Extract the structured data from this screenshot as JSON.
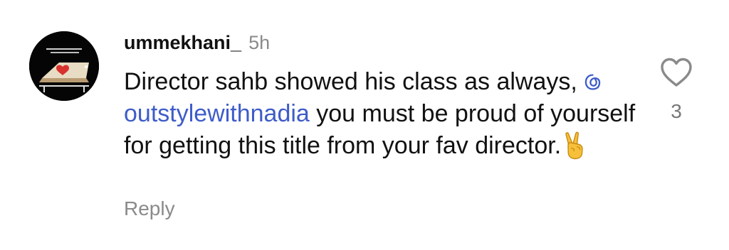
{
  "comment": {
    "username": "ummekhani_",
    "timestamp": "5h",
    "text_before_mention": "Director sahb showed his class as always, ",
    "mention": "outstylewithnadia",
    "text_after_mention": " you must be proud of yourself for getting this title from your fav director.",
    "emoji": "victory-hand",
    "reply_label": "Reply",
    "like_count": "3"
  },
  "colors": {
    "mention": "#3e5cc9",
    "secondary_text": "#8a8a8a",
    "primary_text": "#111111"
  },
  "icons": {
    "like": "heart-outline-icon",
    "mention_prefix": "threads-at-icon",
    "emoji": "victory-hand-emoji"
  }
}
